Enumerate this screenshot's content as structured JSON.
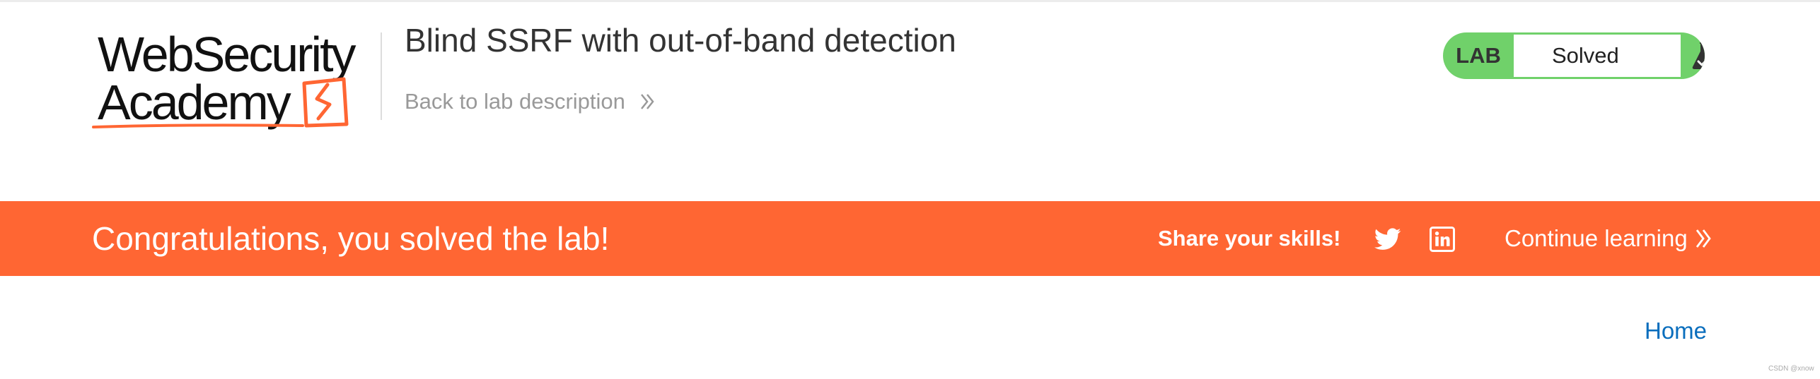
{
  "logo": {
    "line1": "WebSecurity",
    "line2": "Academy",
    "accent_color": "#ff6633"
  },
  "header": {
    "title": "Blind SSRF with out-of-band detection",
    "back_link": "Back to lab description",
    "back_icon": "double-chevron-right-icon"
  },
  "lab_status": {
    "tag": "LAB",
    "state": "Solved",
    "icon": "flask-check-icon",
    "color": "#70d16a"
  },
  "banner": {
    "message": "Congratulations, you solved the lab!",
    "share_label": "Share your skills!",
    "social": [
      "twitter-icon",
      "linkedin-icon"
    ],
    "continue_label": "Continue learning",
    "continue_icon": "double-chevron-right-icon",
    "color": "#ff6633"
  },
  "nav": {
    "home": "Home",
    "link_color": "#0a6ebd"
  },
  "watermark": "CSDN @xnow"
}
